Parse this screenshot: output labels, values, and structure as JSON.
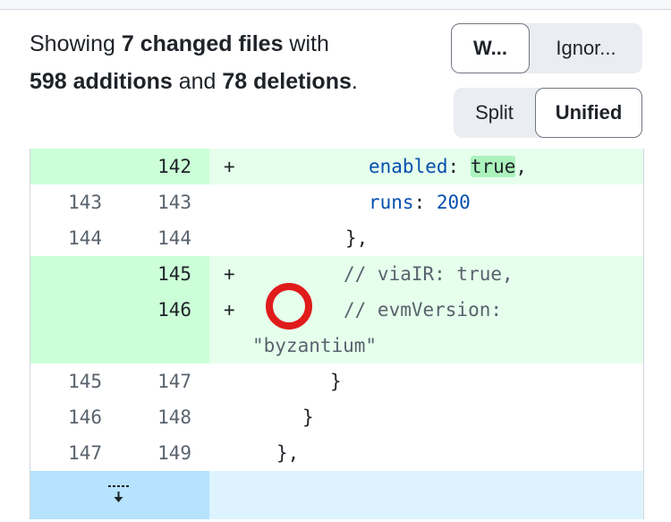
{
  "summary": {
    "prefix": "Showing ",
    "files": "7 changed files",
    "mid1": " with ",
    "additions": "598 additions",
    "mid2": " and ",
    "deletions": "78 deletions",
    "suffix": "."
  },
  "whitespace_toggle": {
    "option1": "W...",
    "option2": "Ignor...",
    "active": "W..."
  },
  "view_toggle": {
    "split": "Split",
    "unified": "Unified",
    "active": "Unified"
  },
  "diff_rows": [
    {
      "old": "",
      "new": "142",
      "marker": "+",
      "type": "add"
    },
    {
      "old": "143",
      "new": "143",
      "marker": "",
      "type": "ctx"
    },
    {
      "old": "144",
      "new": "144",
      "marker": "",
      "type": "ctx"
    },
    {
      "old": "",
      "new": "145",
      "marker": "+",
      "type": "add"
    },
    {
      "old": "",
      "new": "146",
      "marker": "+",
      "type": "add"
    },
    {
      "old": "145",
      "new": "147",
      "marker": "",
      "type": "ctx"
    },
    {
      "old": "146",
      "new": "148",
      "marker": "",
      "type": "ctx"
    },
    {
      "old": "147",
      "new": "149",
      "marker": "",
      "type": "ctx"
    }
  ],
  "code": {
    "l142_key": "enabled",
    "l142_colon": ": ",
    "l142_val": "true",
    "l142_end": ",",
    "l143_key": "runs",
    "l143_colon": ": ",
    "l143_val": "200",
    "l144": "},",
    "l145": "// viaIR: true,",
    "l146a": "// evmVersion:",
    "l146b": "\"byzantium\"",
    "l147": "}",
    "l148": "}",
    "l149": "},"
  },
  "icons": {
    "expand": "expand-down-icon",
    "annotation": "red-circle-annotation"
  },
  "colors": {
    "addition_bg": "#e6ffec",
    "addition_num_bg": "#ccffd8",
    "expand_bg": "#ddf4ff",
    "expand_num_bg": "#b6e3ff",
    "annotation": "#e01b1b"
  }
}
